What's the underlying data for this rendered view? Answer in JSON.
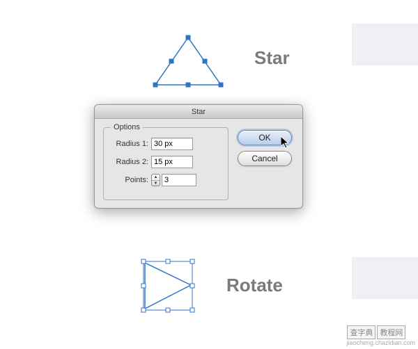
{
  "labels": {
    "star": "Star",
    "rotate": "Rotate"
  },
  "dialog": {
    "title": "Star",
    "options_legend": "Options",
    "radius1_label": "Radius 1:",
    "radius1_value": "30 px",
    "radius2_label": "Radius 2:",
    "radius2_value": "15 px",
    "points_label": "Points:",
    "points_value": "3",
    "ok": "OK",
    "cancel": "Cancel"
  },
  "watermark": {
    "site": "查字典",
    "section": "教程网",
    "url": "jiaocheng.chazidian.com"
  }
}
